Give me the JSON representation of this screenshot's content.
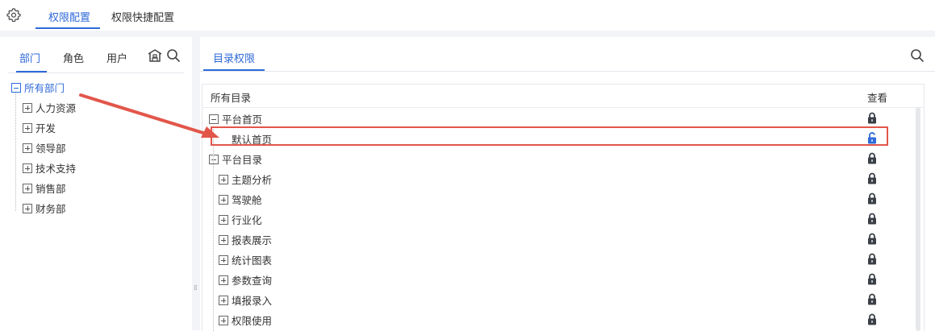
{
  "top_tabs": [
    "权限配置",
    "权限快捷配置"
  ],
  "left_tabs": [
    "部门",
    "角色",
    "用户"
  ],
  "left_tree": {
    "root": "所有部门",
    "children": [
      "人力资源",
      "开发",
      "领导部",
      "技术支持",
      "销售部",
      "财务部"
    ]
  },
  "right_tab": "目录权限",
  "table": {
    "col_dir": "所有目录",
    "col_view": "查看",
    "rows": [
      {
        "label": "平台首页",
        "expander": "minus",
        "lock": "locked"
      },
      {
        "label": "默认首页",
        "expander": "none",
        "lock": "unlocked"
      },
      {
        "label": "平台目录",
        "expander": "minus",
        "lock": "locked"
      },
      {
        "label": "主题分析",
        "expander": "plus",
        "lock": "locked"
      },
      {
        "label": "驾驶舱",
        "expander": "plus",
        "lock": "locked"
      },
      {
        "label": "行业化",
        "expander": "plus",
        "lock": "locked"
      },
      {
        "label": "报表展示",
        "expander": "plus",
        "lock": "locked"
      },
      {
        "label": "统计图表",
        "expander": "plus",
        "lock": "locked"
      },
      {
        "label": "参数查询",
        "expander": "plus",
        "lock": "locked"
      },
      {
        "label": "填报录入",
        "expander": "plus",
        "lock": "locked"
      },
      {
        "label": "权限使用",
        "expander": "plus",
        "lock": "locked"
      }
    ]
  },
  "colors": {
    "accent": "#2f6ad8",
    "annotation_red": "#e2564a",
    "lock_dark": "#3a3f47"
  }
}
